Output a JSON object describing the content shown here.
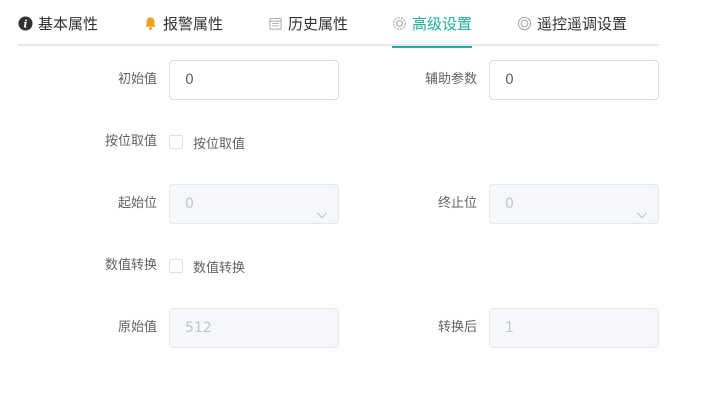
{
  "tabs": [
    {
      "label": "基本属性",
      "icon": "info-circle-icon"
    },
    {
      "label": "报警属性",
      "icon": "bell-icon"
    },
    {
      "label": "历史属性",
      "icon": "calendar-icon"
    },
    {
      "label": "高级设置",
      "icon": "gear-icon",
      "active": true
    },
    {
      "label": "遥控遥调设置",
      "icon": "remote-control-icon"
    }
  ],
  "colors": {
    "accent": "#1fae9c",
    "bell": "#f0a020"
  },
  "form": {
    "initial_value": {
      "label": "初始值",
      "value": "0"
    },
    "aux_param": {
      "label": "辅助参数",
      "value": "0"
    },
    "bit_extract": {
      "label": "按位取值",
      "checkbox_label": "按位取值",
      "checked": false
    },
    "start_bit": {
      "label": "起始位",
      "value": "0"
    },
    "end_bit": {
      "label": "终止位",
      "value": "0"
    },
    "value_convert": {
      "label": "数值转换",
      "checkbox_label": "数值转换",
      "checked": false
    },
    "original_value": {
      "label": "原始值",
      "value": "512"
    },
    "converted_value": {
      "label": "转换后",
      "value": "1"
    }
  }
}
